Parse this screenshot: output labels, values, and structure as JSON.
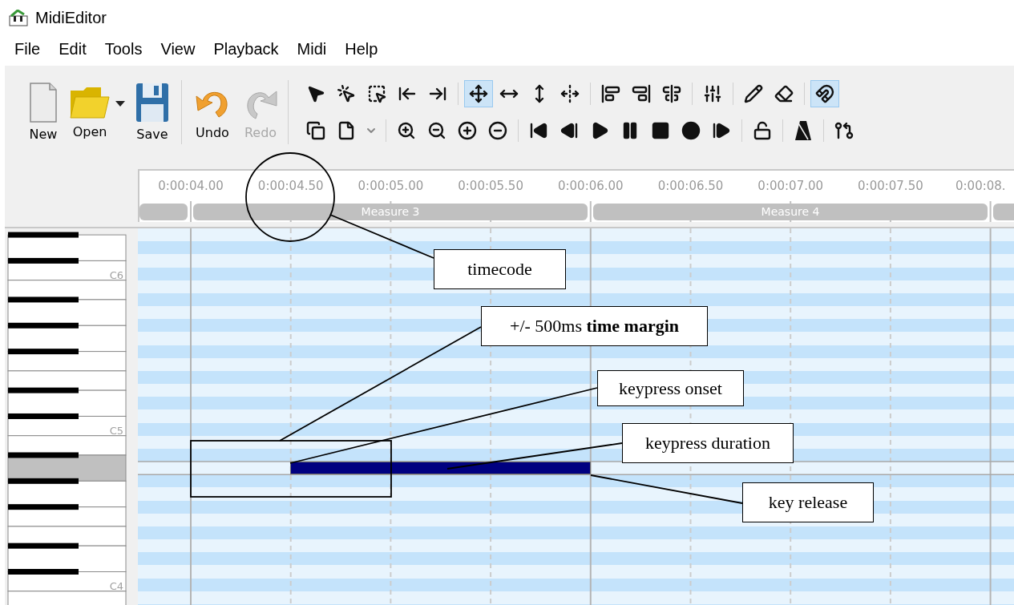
{
  "window": {
    "title": "MidiEditor"
  },
  "menu": [
    "File",
    "Edit",
    "Tools",
    "View",
    "Playback",
    "Midi",
    "Help"
  ],
  "file_buttons": [
    {
      "kind": "new",
      "label": "New",
      "disabled": false
    },
    {
      "kind": "open",
      "label": "Open",
      "disabled": false
    },
    {
      "kind": "save",
      "label": "Save",
      "disabled": false
    },
    {
      "kind": "separator"
    },
    {
      "kind": "undo",
      "label": "Undo",
      "disabled": false
    },
    {
      "kind": "redo",
      "label": "Redo",
      "disabled": true
    }
  ],
  "tools_row_1": [
    {
      "kind": "pointer",
      "selected": false
    },
    {
      "kind": "select-single",
      "selected": false
    },
    {
      "kind": "box-select",
      "selected": false
    },
    {
      "kind": "select-left",
      "selected": false
    },
    {
      "kind": "select-right",
      "selected": false
    },
    {
      "kind": "separator"
    },
    {
      "kind": "move",
      "selected": true
    },
    {
      "kind": "move-h",
      "selected": false
    },
    {
      "kind": "move-v",
      "selected": false
    },
    {
      "kind": "resize",
      "selected": false
    },
    {
      "kind": "separator"
    },
    {
      "kind": "align-left",
      "selected": false
    },
    {
      "kind": "align-right",
      "selected": false
    },
    {
      "kind": "equalize",
      "selected": false
    },
    {
      "kind": "separator"
    },
    {
      "kind": "quantize",
      "selected": false
    },
    {
      "kind": "separator"
    },
    {
      "kind": "pencil",
      "selected": false
    },
    {
      "kind": "eraser",
      "selected": false
    },
    {
      "kind": "separator"
    },
    {
      "kind": "magnet",
      "selected": true
    }
  ],
  "tools_row_2": [
    {
      "kind": "copy",
      "selected": false
    },
    {
      "kind": "paste",
      "selected": false
    },
    {
      "kind": "dropdown",
      "selected": false
    },
    {
      "kind": "separator"
    },
    {
      "kind": "zoom-h-in",
      "selected": false
    },
    {
      "kind": "zoom-h-out",
      "selected": false
    },
    {
      "kind": "zoom-v-in",
      "selected": false
    },
    {
      "kind": "zoom-v-out",
      "selected": false
    },
    {
      "kind": "separator"
    },
    {
      "kind": "to-begin",
      "selected": false
    },
    {
      "kind": "back",
      "selected": false
    },
    {
      "kind": "play",
      "selected": false
    },
    {
      "kind": "pause",
      "selected": false
    },
    {
      "kind": "stop",
      "selected": false
    },
    {
      "kind": "record",
      "selected": false
    },
    {
      "kind": "forward",
      "selected": false
    },
    {
      "kind": "separator"
    },
    {
      "kind": "lock",
      "selected": false
    },
    {
      "kind": "separator"
    },
    {
      "kind": "metronome",
      "selected": false
    },
    {
      "kind": "separator"
    },
    {
      "kind": "thru",
      "selected": false
    }
  ],
  "ruler": {
    "times": [
      "0:00:04.00",
      "0:00:04.50",
      "0:00:05.00",
      "0:00:05.50",
      "0:00:06.00",
      "0:00:06.50",
      "0:00:07.00",
      "0:00:07.50",
      "0:00:08."
    ],
    "measures": [
      "Measure 3",
      "Measure 4"
    ]
  },
  "keyboard": {
    "octave_labels": [
      "C6",
      "C5",
      "C4"
    ]
  },
  "annotations": [
    {
      "text": "timecode"
    },
    {
      "text": "+/- 500ms **time margin**"
    },
    {
      "text": "keypress onset"
    },
    {
      "text": "keypress duration"
    },
    {
      "text": "key release"
    }
  ]
}
